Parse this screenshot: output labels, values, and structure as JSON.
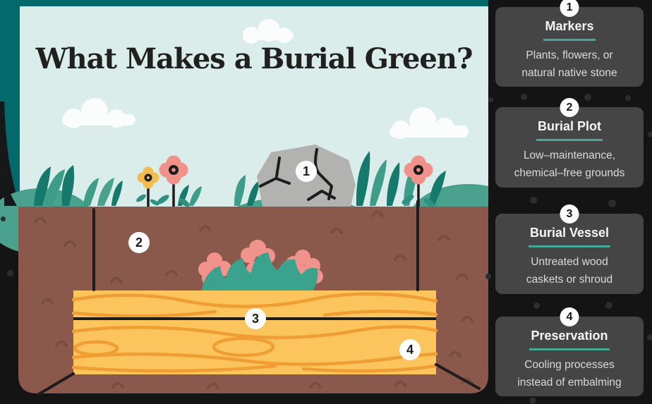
{
  "illustration": {
    "title": "What Makes a Burial Green?",
    "markers": [
      {
        "number": "1"
      },
      {
        "number": "2"
      },
      {
        "number": "3"
      },
      {
        "number": "4"
      }
    ]
  },
  "sidebar": {
    "cards": [
      {
        "number": "1",
        "title": "Markers",
        "line1": "Plants, flowers, or",
        "line2": "natural native stone"
      },
      {
        "number": "2",
        "title": "Burial Plot",
        "line1": "Low–maintenance,",
        "line2": "chemical–free grounds"
      },
      {
        "number": "3",
        "title": "Burial Vessel",
        "line1": "Untreated wood",
        "line2": "caskets or shroud"
      },
      {
        "number": "4",
        "title": "Preservation",
        "line1": "Cooling processes",
        "line2": "instead of embalming"
      }
    ]
  },
  "colors": {
    "page_background": "#141414",
    "frame_teal": "#03696b",
    "sky_mint": "#daedea",
    "cloud_white": "#fbfdfd",
    "dirt_brown": "#8a594c",
    "dirt_speckle": "#7a4d42",
    "casket_yellow": "#fcc45c",
    "wood_grain_orange": "#f09e33",
    "grass_light": "#4aa18d",
    "grass_dark": "#157a6b",
    "grass_mid": "#3d9d89",
    "coral_flower": "#f1918b",
    "yellow_flower": "#f3bc4d",
    "bouquet_pink": "#f2928c",
    "rock_gray": "#b2b2b0",
    "outline_black": "#1d1d1d",
    "card_background": "#454546",
    "card_underline_teal": "#45a795",
    "card_title_text": "#f6f6f6",
    "card_body_text": "#dadada",
    "title_text": "#20201e"
  }
}
